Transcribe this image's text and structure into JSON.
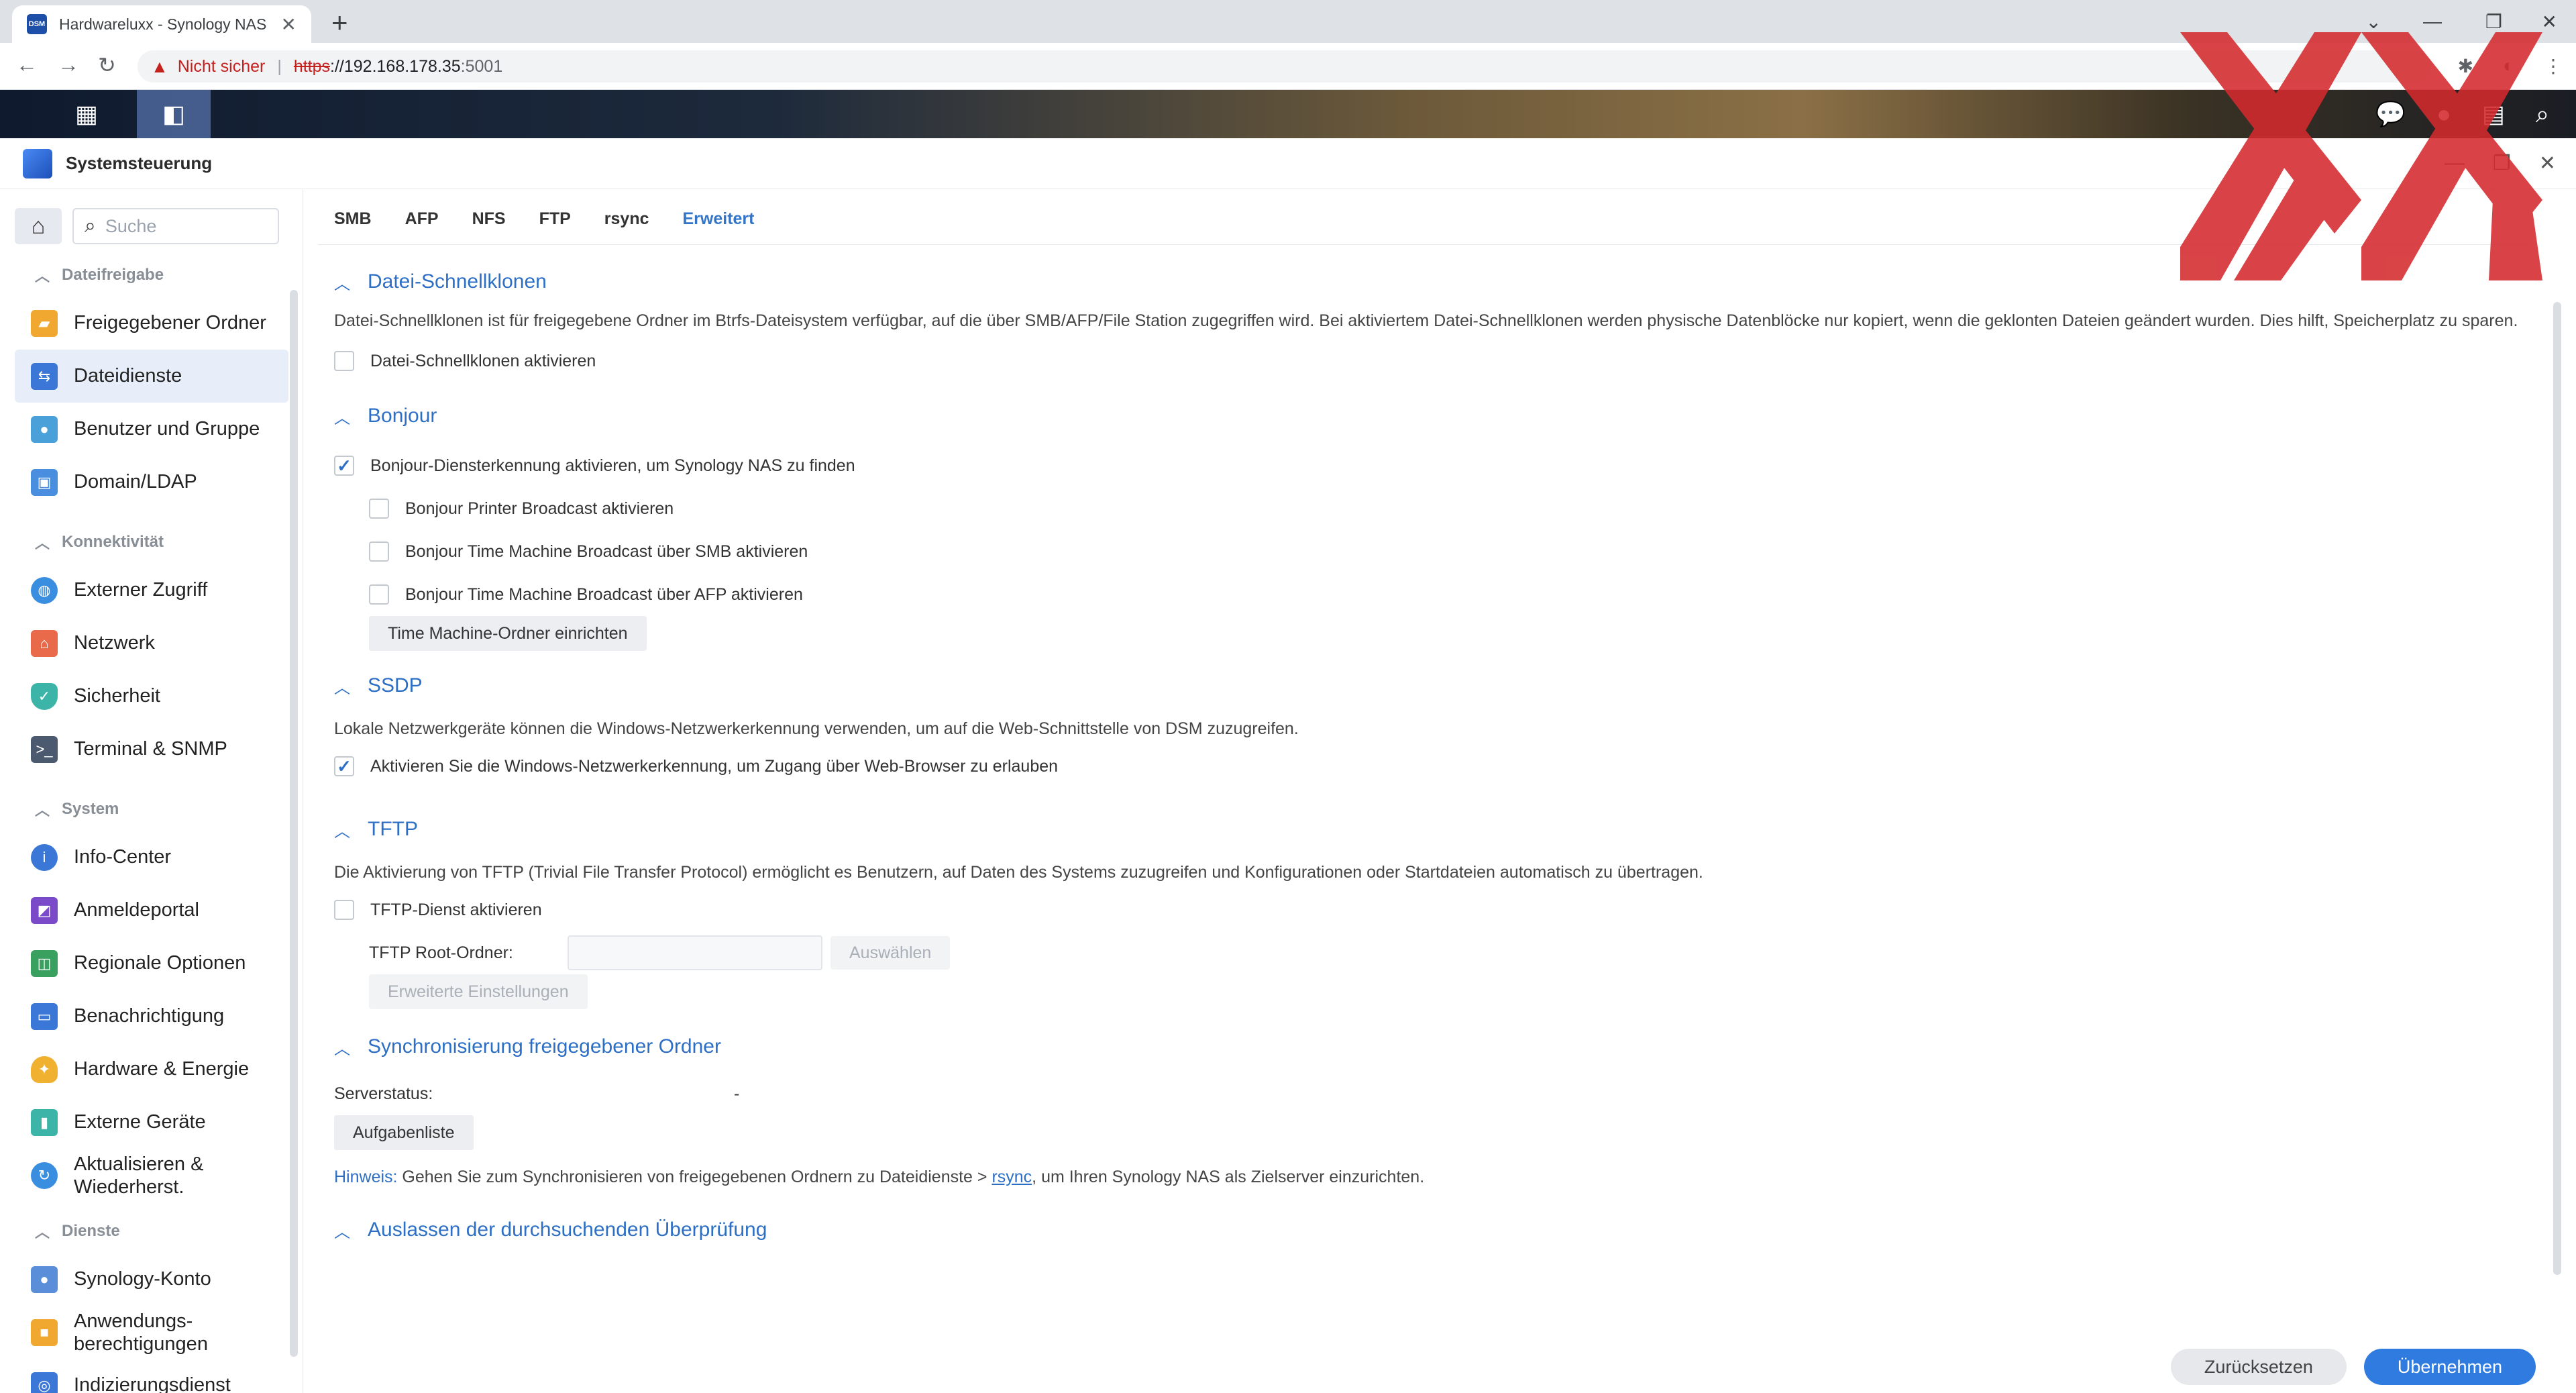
{
  "browser": {
    "tab_title": "Hardwareluxx - Synology NAS",
    "favicon_text": "DSM",
    "new_tab": "+",
    "close_tab": "✕",
    "insecure_label": "Nicht sicher",
    "url_scheme": "https",
    "url_host": "://192.168.178.35",
    "url_port": ":5001"
  },
  "window": {
    "title": "Systemsteuerung"
  },
  "sidebar": {
    "search_placeholder": "Suche",
    "sections": [
      {
        "title": "Dateifreigabe",
        "items": [
          "Freigegebener Ordner",
          "Dateidienste",
          "Benutzer und Gruppe",
          "Domain/LDAP"
        ]
      },
      {
        "title": "Konnektivität",
        "items": [
          "Externer Zugriff",
          "Netzwerk",
          "Sicherheit",
          "Terminal & SNMP"
        ]
      },
      {
        "title": "System",
        "items": [
          "Info-Center",
          "Anmeldeportal",
          "Regionale Optionen",
          "Benachrichtigung",
          "Hardware & Energie",
          "Externe Geräte",
          "Aktualisieren & Wiederherst."
        ]
      },
      {
        "title": "Dienste",
        "items": [
          "Synology-Konto",
          "Anwendungs-berechtigungen",
          "Indizierungsdienst"
        ]
      }
    ],
    "active_item": "Dateidienste"
  },
  "tabs": [
    "SMB",
    "AFP",
    "NFS",
    "FTP",
    "rsync",
    "Erweitert"
  ],
  "active_tab": "Erweitert",
  "sections": {
    "clone": {
      "title": "Datei-Schnellklonen",
      "desc": "Datei-Schnellklonen ist für freigegebene Ordner im Btrfs-Dateisystem verfügbar, auf die über SMB/AFP/File Station zugegriffen wird. Bei aktiviertem Datei-Schnellklonen werden physische Datenblöcke nur kopiert, wenn die geklonten Dateien geändert wurden. Dies hilft, Speicherplatz zu sparen.",
      "checkbox": "Datei-Schnellklonen aktivieren",
      "checked": false
    },
    "bonjour": {
      "title": "Bonjour",
      "main_checkbox": "Bonjour-Diensterkennung aktivieren, um Synology NAS zu finden",
      "main_checked": true,
      "sub": [
        {
          "label": "Bonjour Printer Broadcast aktivieren",
          "checked": false
        },
        {
          "label": "Bonjour Time Machine Broadcast über SMB aktivieren",
          "checked": false
        },
        {
          "label": "Bonjour Time Machine Broadcast über AFP aktivieren",
          "checked": false
        }
      ],
      "button": "Time Machine-Ordner einrichten"
    },
    "ssdp": {
      "title": "SSDP",
      "desc": "Lokale Netzwerkgeräte können die Windows-Netzwerkerkennung verwenden, um auf die Web-Schnittstelle von DSM zuzugreifen.",
      "checkbox": "Aktivieren Sie die Windows-Netzwerkerkennung, um Zugang über Web-Browser zu erlauben",
      "checked": true
    },
    "tftp": {
      "title": "TFTP",
      "desc": "Die Aktivierung von TFTP (Trivial File Transfer Protocol) ermöglicht es Benutzern, auf Daten des Systems zuzugreifen und Konfigurationen oder Startdateien automatisch zu übertragen.",
      "checkbox": "TFTP-Dienst aktivieren",
      "checked": false,
      "root_label": "TFTP Root-Ordner:",
      "root_value": "",
      "select_button": "Auswählen",
      "advanced_button": "Erweiterte Einstellungen"
    },
    "sync": {
      "title": "Synchronisierung freigegebener Ordner",
      "status_label": "Serverstatus:",
      "status_value": "-",
      "button": "Aufgabenliste",
      "hint_label": "Hinweis:",
      "hint_text": " Gehen Sie zum Synchronisieren von freigegebenen Ordnern zu Dateidienste > ",
      "hint_link": "rsync",
      "hint_text2": ", um Ihren Synology NAS als Zielserver einzurichten."
    },
    "skip": {
      "title": "Auslassen der durchsuchenden Überprüfung"
    }
  },
  "footer": {
    "reset": "Zurücksetzen",
    "apply": "Übernehmen"
  },
  "colors": {
    "accent": "#2d6fc4",
    "apply_button": "#2f7be0",
    "watermark": "#d42a2e"
  }
}
